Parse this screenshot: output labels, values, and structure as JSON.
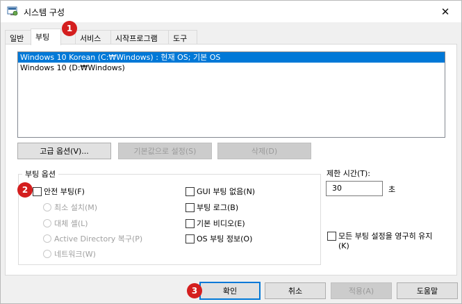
{
  "window": {
    "title": "시스템 구성",
    "close_glyph": "✕"
  },
  "tabs": [
    {
      "label": "일반"
    },
    {
      "label": "부팅"
    },
    {
      "label": "서비스"
    },
    {
      "label": "시작프로그램"
    },
    {
      "label": "도구"
    }
  ],
  "os_list": [
    "Windows 10 Korean (C:₩Windows) : 현재 OS; 기본 OS",
    "Windows 10 (D:₩Windows)"
  ],
  "buttons": {
    "advanced": "고급 옵션(V)...",
    "set_default": "기본값으로 설정(S)",
    "delete": "삭제(D)"
  },
  "boot_options": {
    "title": "부팅 옵션",
    "safe_boot": "안전 부팅(F)",
    "minimal": "최소 설치(M)",
    "alternate_shell": "대체 셸(L)",
    "ad_repair": "Active Directory 복구(P)",
    "network": "네트워크(W)",
    "no_gui_boot": "GUI 부팅 없음(N)",
    "boot_log": "부팅 로그(B)",
    "base_video": "기본 비디오(E)",
    "os_boot_info": "OS 부팅 정보(O)"
  },
  "timeout": {
    "label": "제한 시간(T):",
    "value": "30",
    "unit": "초"
  },
  "make_permanent": {
    "line1": "모든 부팅 설정을 영구히 유지",
    "line2": "(K)"
  },
  "footer": {
    "ok": "확인",
    "cancel": "취소",
    "apply": "적용(A)",
    "help": "도움말"
  },
  "callouts": [
    "1",
    "2",
    "3"
  ],
  "colors": {
    "selection": "#0078d7",
    "callout": "#d41e1e"
  }
}
